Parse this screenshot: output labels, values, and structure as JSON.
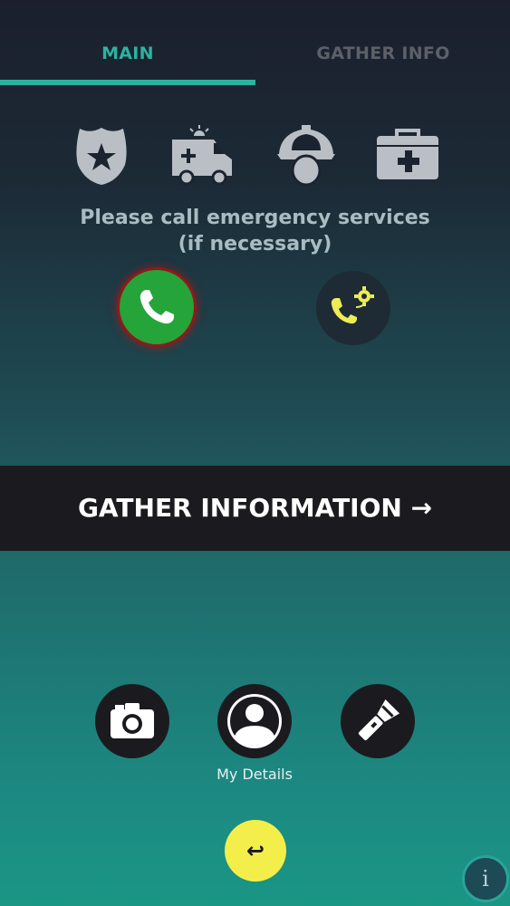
{
  "tabs": [
    {
      "label": "MAIN",
      "active": true
    },
    {
      "label": "GATHER INFO",
      "active": false
    }
  ],
  "services": {
    "icons": [
      "police-badge-icon",
      "ambulance-icon",
      "firefighter-icon",
      "first-aid-kit-icon"
    ],
    "message_line1": "Please call emergency services",
    "message_line2": "(if necessary)"
  },
  "calls": {
    "call_icon": "phone-icon",
    "settings_icon": "phone-settings-icon"
  },
  "gather": {
    "label": "GATHER INFORMATION →"
  },
  "tools": {
    "camera_icon": "camera-icon",
    "details_icon": "user-icon",
    "details_label": "My Details",
    "flashlight_icon": "flashlight-icon"
  },
  "back": {
    "glyph": "↩"
  },
  "info": {
    "glyph": "i"
  },
  "colors": {
    "accent": "#2bb3a0",
    "call_green": "#25a43a",
    "back_yellow": "#f4ee4b",
    "bar_dark": "#1b1a1e"
  }
}
